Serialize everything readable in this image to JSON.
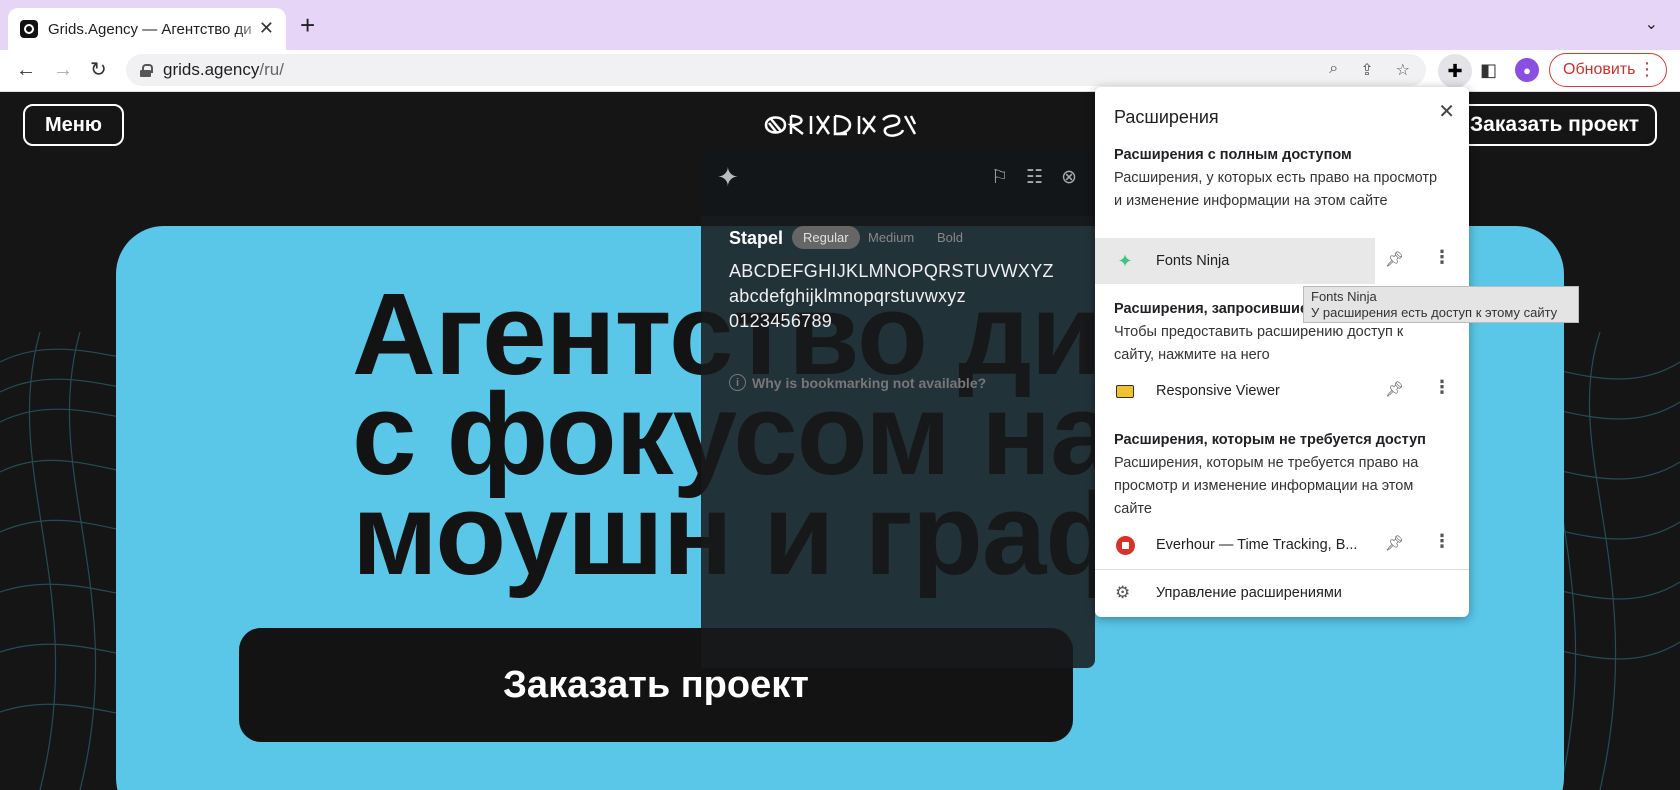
{
  "browser": {
    "tab_title": "Grids.Agency — Агентство ди",
    "url_domain": "grids.agency",
    "url_path": "/ru/",
    "update_label": "Обновить"
  },
  "site": {
    "menu_label": "Меню",
    "order_label": "Заказать проект",
    "hero_lines": [
      "Агентство дизай",
      "с фокусом на UI",
      "моушн и графика"
    ],
    "hero_cta": "Заказать проект",
    "hero_color": "#5ac6e8"
  },
  "fonts_ninja": {
    "font_name": "Stapel",
    "weights": [
      "Regular",
      "Medium",
      "Bold"
    ],
    "selected_weight": "Regular",
    "uppercase": "ABCDEFGHIJKLMNOPQRSTUVWXYZ",
    "lowercase": "abcdefghijklmnopqrstuvwxyz",
    "digits": "0123456789",
    "bookmark_note": "Why is bookmarking not available?"
  },
  "extensions": {
    "title": "Расширения",
    "sections": [
      {
        "title": "Расширения с полным доступом",
        "desc": "Расширения, у которых есть право на просмотр и изменение информации на этом сайте"
      },
      {
        "title": "Расширения, запросившие доступ",
        "desc": "Чтобы предоставить расширению доступ к сайту, нажмите на него"
      },
      {
        "title": "Расширения, которым не требуется доступ",
        "desc": "Расширения, которым не требуется право на просмотр и изменение информации на этом сайте"
      }
    ],
    "items": [
      {
        "name": "Fonts Ninja",
        "icon": "ninja-icon"
      },
      {
        "name": "Responsive Viewer",
        "icon": "responsive-viewer-icon"
      },
      {
        "name": "Everhour — Time Tracking, B...",
        "icon": "everhour-icon"
      }
    ],
    "manage_label": "Управление расширениями"
  },
  "tooltip": {
    "title": "Fonts Ninja",
    "text": "У расширения есть доступ к этому сайту"
  }
}
